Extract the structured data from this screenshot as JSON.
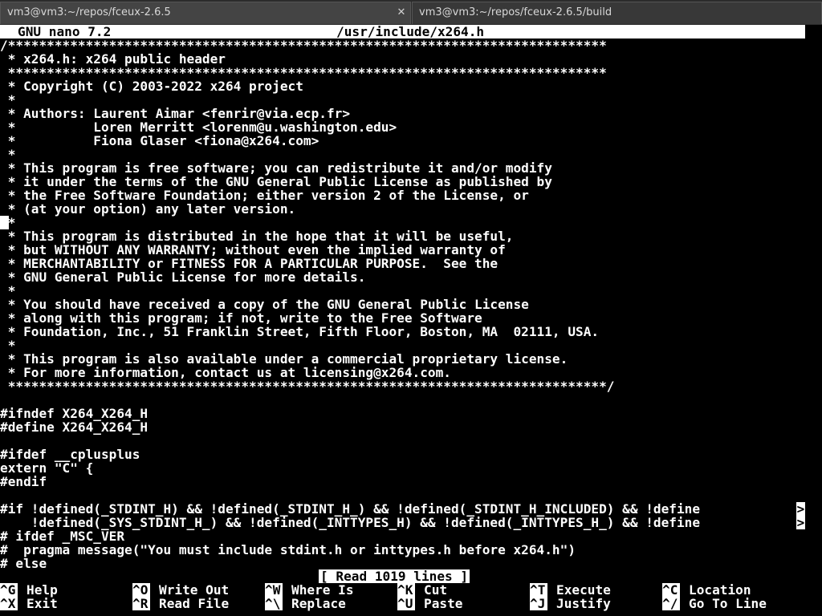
{
  "tabs": [
    {
      "title": "vm3@vm3:~/repos/fceux-2.6.5",
      "close": "✕"
    },
    {
      "title": "vm3@vm3:~/repos/fceux-2.6.5/build"
    }
  ],
  "nano": {
    "version": "GNU nano 7.2",
    "filename": "/usr/include/x264.h",
    "status_message": "[ Read 1019 lines ]",
    "overflow_indicator": ">"
  },
  "file_lines": [
    "/*****************************************************************************",
    " * x264.h: x264 public header",
    " *****************************************************************************",
    " * Copyright (C) 2003-2022 x264 project",
    " *",
    " * Authors: Laurent Aimar <fenrir@via.ecp.fr>",
    " *          Loren Merritt <lorenm@u.washington.edu>",
    " *          Fiona Glaser <fiona@x264.com>",
    " *",
    " * This program is free software; you can redistribute it and/or modify",
    " * it under the terms of the GNU General Public License as published by",
    " * the Free Software Foundation; either version 2 of the License, or",
    " * (at your option) any later version.",
    " *",
    " * This program is distributed in the hope that it will be useful,",
    " * but WITHOUT ANY WARRANTY; without even the implied warranty of",
    " * MERCHANTABILITY or FITNESS FOR A PARTICULAR PURPOSE.  See the",
    " * GNU General Public License for more details.",
    " *",
    " * You should have received a copy of the GNU General Public License",
    " * along with this program; if not, write to the Free Software",
    " * Foundation, Inc., 51 Franklin Street, Fifth Floor, Boston, MA  02111, USA.",
    " *",
    " * This program is also available under a commercial proprietary license.",
    " * For more information, contact us at licensing@x264.com.",
    " *****************************************************************************/",
    "",
    "#ifndef X264_X264_H",
    "#define X264_X264_H",
    "",
    "#ifdef __cplusplus",
    "extern \"C\" {",
    "#endif",
    "",
    "#if !defined(_STDINT_H) && !defined(_STDINT_H_) && !defined(_STDINT_H_INCLUDED) && !define",
    "    !defined(_SYS_STDINT_H_) && !defined(_INTTYPES_H) && !defined(_INTTYPES_H_) && !define",
    "# ifdef _MSC_VER",
    "#  pragma message(\"You must include stdint.h or inttypes.h before x264.h\")",
    "# else"
  ],
  "shortcuts": [
    [
      {
        "key": "^G",
        "label": "Help"
      },
      {
        "key": "^O",
        "label": "Write Out"
      },
      {
        "key": "^W",
        "label": "Where Is"
      },
      {
        "key": "^K",
        "label": "Cut"
      },
      {
        "key": "^T",
        "label": "Execute"
      },
      {
        "key": "^C",
        "label": "Location"
      }
    ],
    [
      {
        "key": "^X",
        "label": "Exit"
      },
      {
        "key": "^R",
        "label": "Read File"
      },
      {
        "key": "^\\",
        "label": "Replace"
      },
      {
        "key": "^U",
        "label": "Paste"
      },
      {
        "key": "^J",
        "label": "Justify"
      },
      {
        "key": "^/",
        "label": "Go To Line"
      }
    ]
  ]
}
